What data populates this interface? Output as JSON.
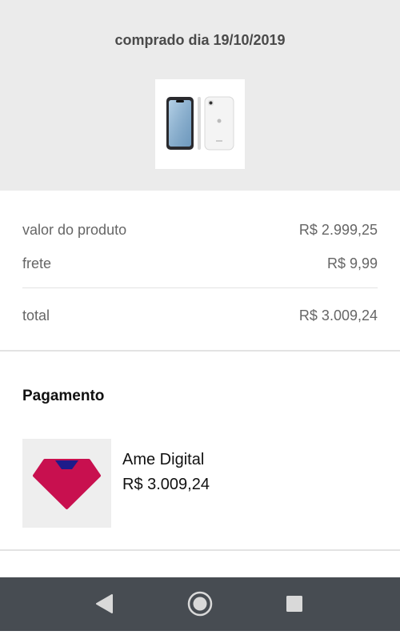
{
  "order": {
    "purchase_date_label": "comprado dia 19/10/2019",
    "product_image_icon": "iphone-xr-product-image"
  },
  "summary": {
    "product_value_label": "valor do produto",
    "product_value": "R$ 2.999,25",
    "shipping_label": "frete",
    "shipping_value": "R$ 9,99",
    "total_label": "total",
    "total_value": "R$ 3.009,24"
  },
  "payment": {
    "title": "Pagamento",
    "method_name": "Ame Digital",
    "method_amount": "R$ 3.009,24",
    "logo_icon": "ame-digital-logo",
    "brand_color": "#c8104f",
    "brand_accent": "#1e1b8a"
  },
  "navigation": {
    "back_icon": "back-triangle-icon",
    "home_icon": "home-circle-icon",
    "recents_icon": "recents-square-icon"
  }
}
